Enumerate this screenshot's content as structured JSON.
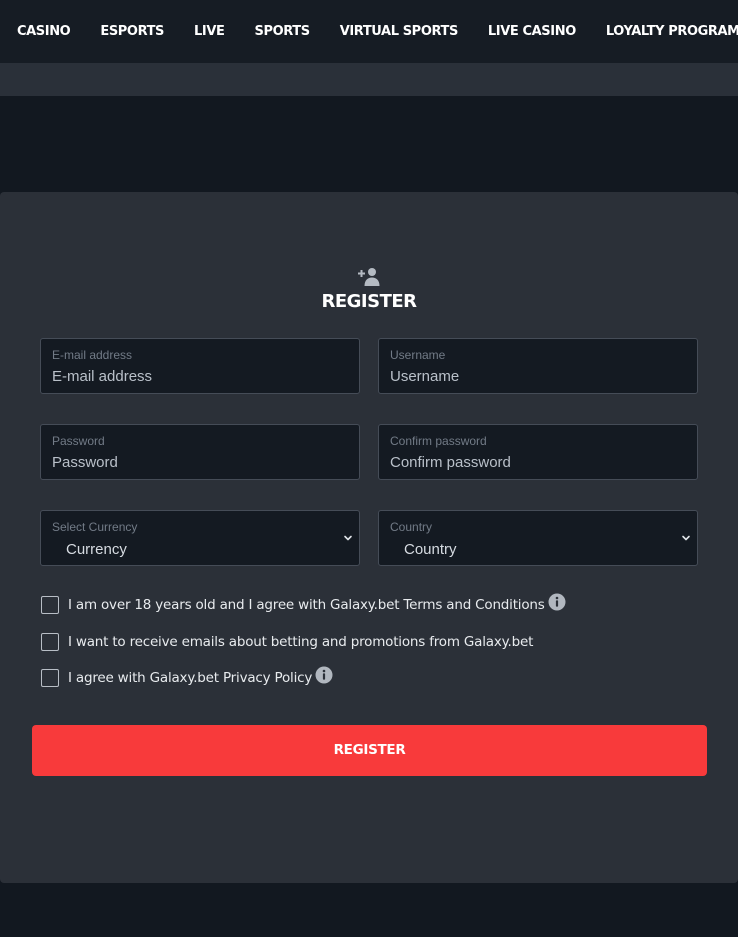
{
  "nav": {
    "items": [
      {
        "label": "CASINO"
      },
      {
        "label": "ESPORTS"
      },
      {
        "label": "LIVE"
      },
      {
        "label": "SPORTS"
      },
      {
        "label": "VIRTUAL SPORTS"
      },
      {
        "label": "LIVE CASINO"
      },
      {
        "label": "LOYALTY PROGRAM"
      }
    ]
  },
  "register": {
    "icon": "add-user-icon",
    "title": "REGISTER",
    "fields": {
      "email": {
        "label": "E-mail address",
        "placeholder": "E-mail address"
      },
      "username": {
        "label": "Username",
        "placeholder": "Username"
      },
      "password": {
        "label": "Password",
        "placeholder": "Password"
      },
      "confirm_password": {
        "label": "Confirm password",
        "placeholder": "Confirm password"
      },
      "currency": {
        "label": "Select Currency",
        "value": "Currency"
      },
      "country": {
        "label": "Country",
        "value": "Country"
      }
    },
    "checkboxes": {
      "age_terms": {
        "text": "I am over 18 years old and I agree with Galaxy.bet Terms and Conditions",
        "checked": false
      },
      "emails": {
        "text": "I want to receive emails about betting and promotions from Galaxy.bet",
        "checked": false
      },
      "privacy": {
        "text": "I agree with Galaxy.bet Privacy Policy",
        "checked": false
      }
    },
    "submit_label": "REGISTER"
  },
  "colors": {
    "page_bg": "#121820",
    "nav_bg": "#161c24",
    "panel_bg": "#2b3038",
    "field_bg": "#141a22",
    "accent": "#f83a3b"
  }
}
